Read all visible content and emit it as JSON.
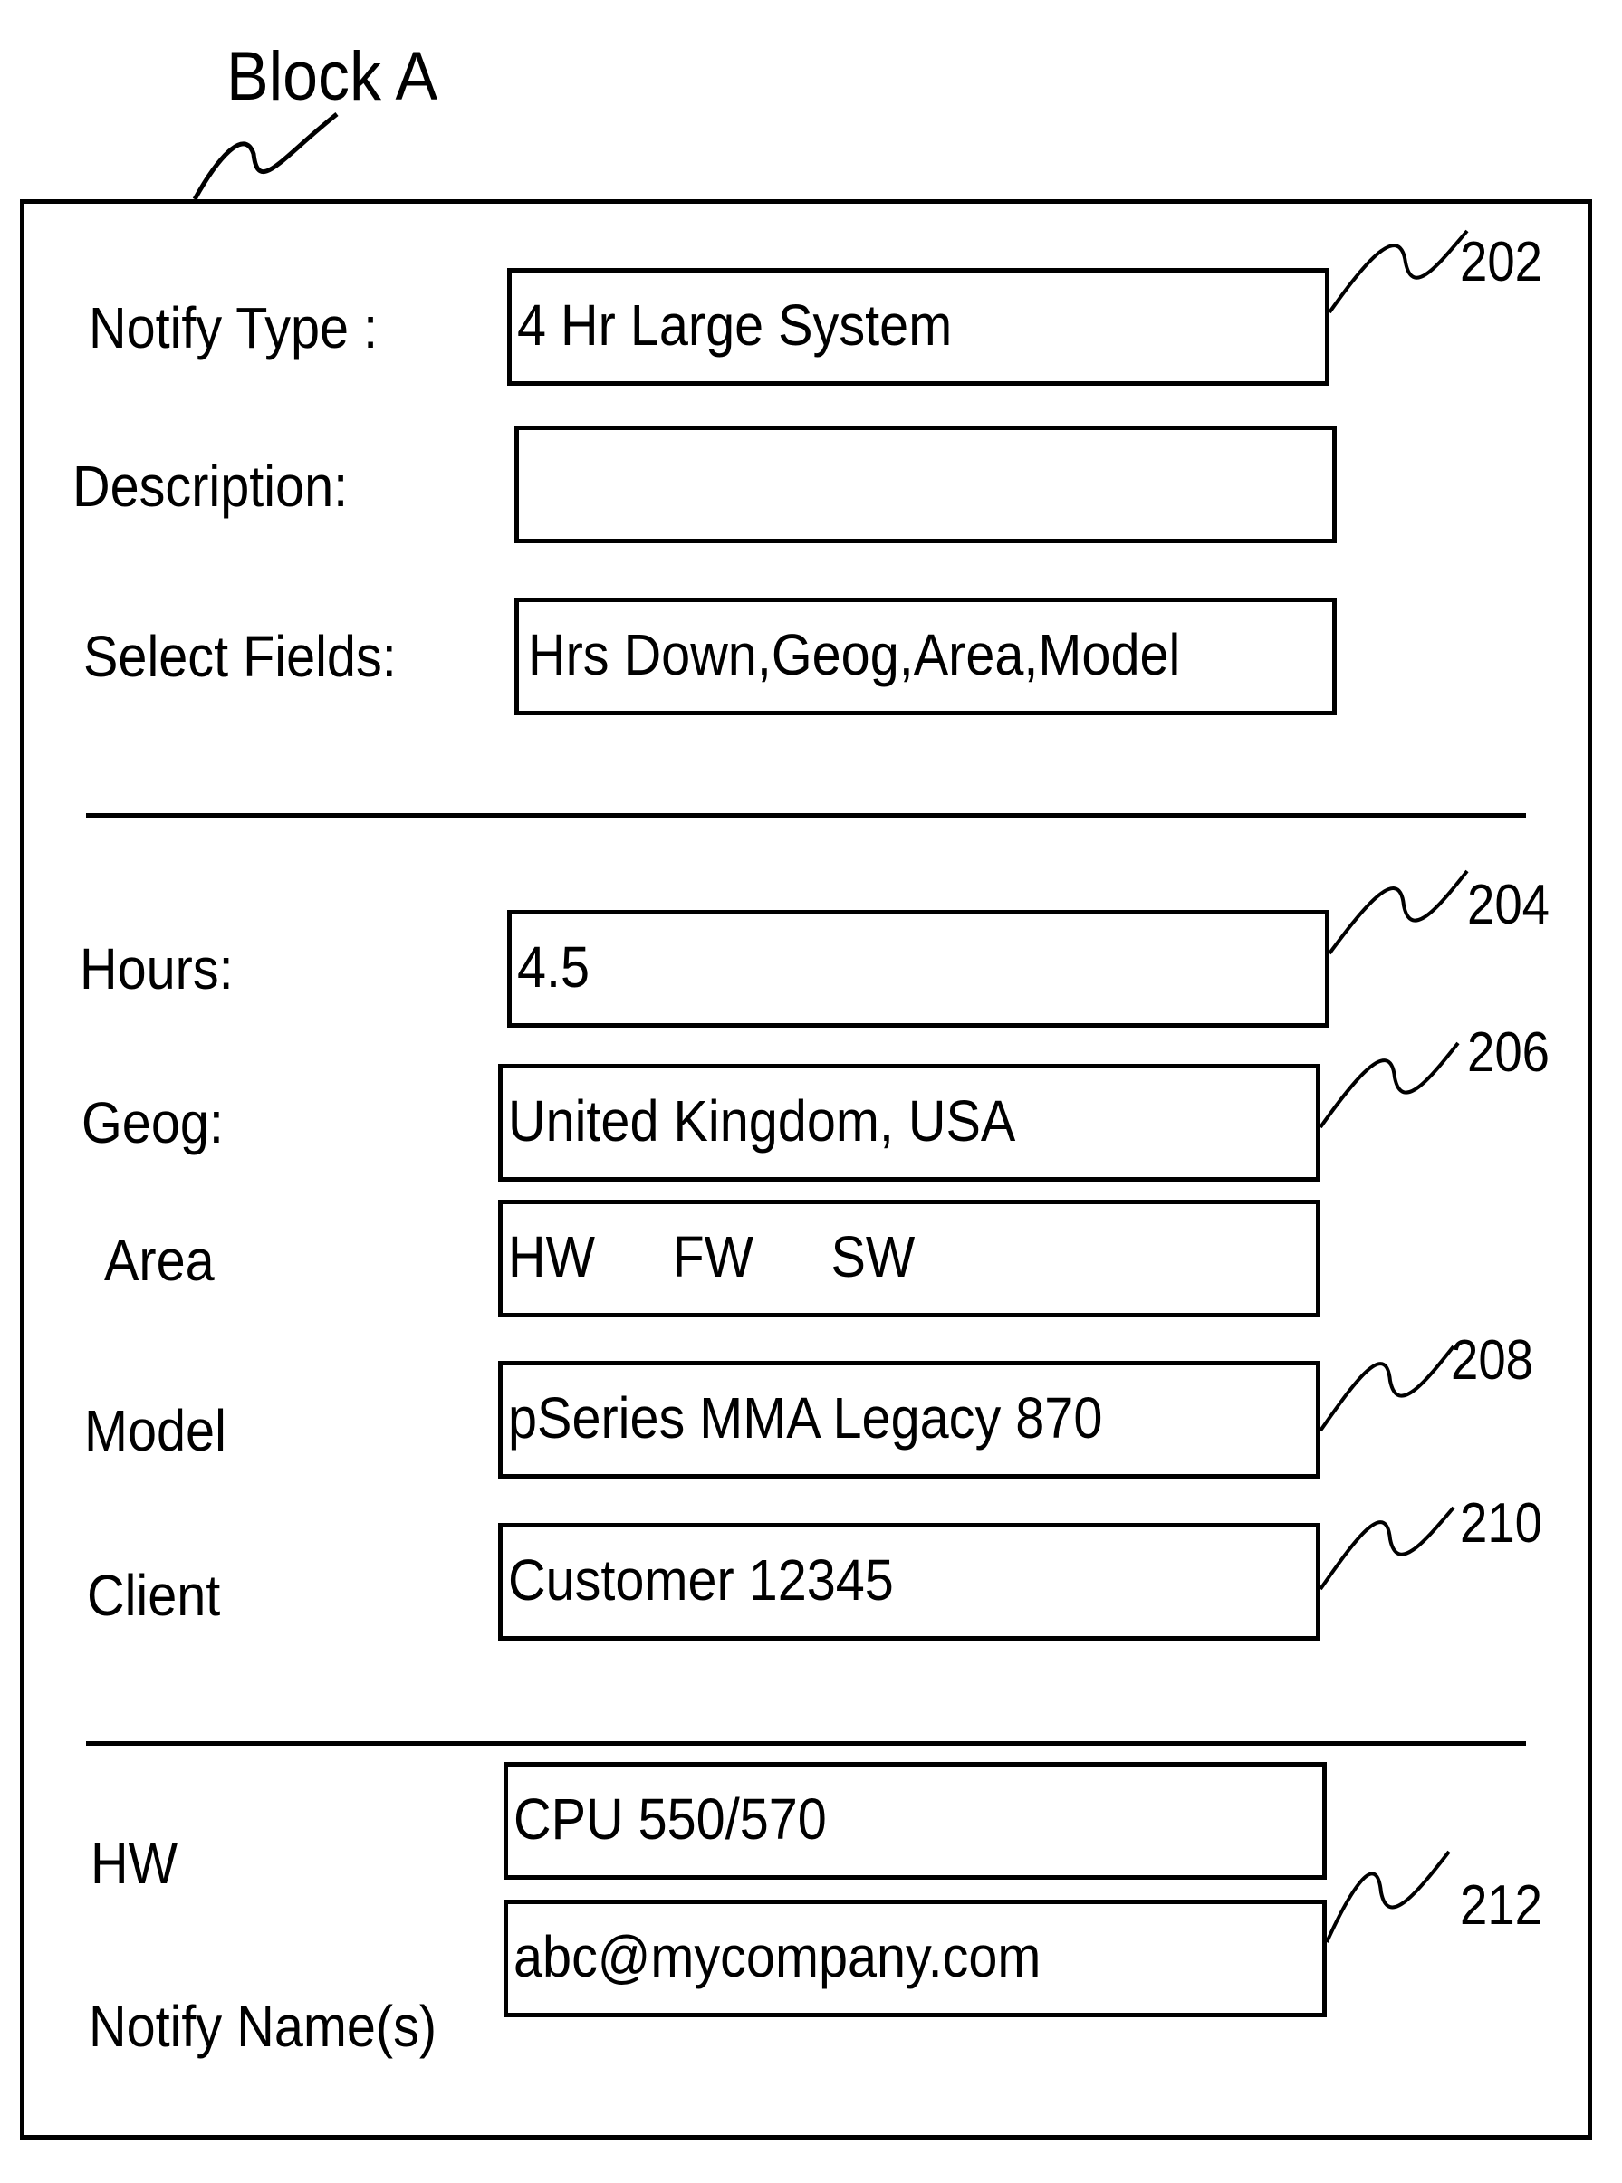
{
  "figure": {
    "title": "Block A"
  },
  "form": {
    "top": {
      "notify_type": {
        "label": "Notify Type :",
        "value": "4 Hr Large System",
        "ref": "202"
      },
      "description": {
        "label": "Description:",
        "value": ""
      },
      "select_fields": {
        "label": "Select Fields:",
        "value": "Hrs Down,Geog,Area,Model"
      }
    },
    "criteria": {
      "hours": {
        "label": "Hours:",
        "value": "4.5",
        "ref": "204"
      },
      "geog": {
        "label": "Geog:",
        "value": "United Kingdom, USA",
        "ref": "206"
      },
      "area": {
        "label": "Area",
        "options": [
          "HW",
          "FW",
          "SW"
        ]
      },
      "model": {
        "label": "Model",
        "value": "pSeries MMA Legacy 870",
        "ref": "208"
      },
      "client": {
        "label": "Client",
        "value": "Customer 12345",
        "ref": "210"
      }
    },
    "bottom": {
      "hw": {
        "label": "HW",
        "value": "CPU 550/570"
      },
      "notify_names": {
        "label": "Notify Name(s)",
        "value": "abc@mycompany.com",
        "ref": "212"
      }
    }
  }
}
